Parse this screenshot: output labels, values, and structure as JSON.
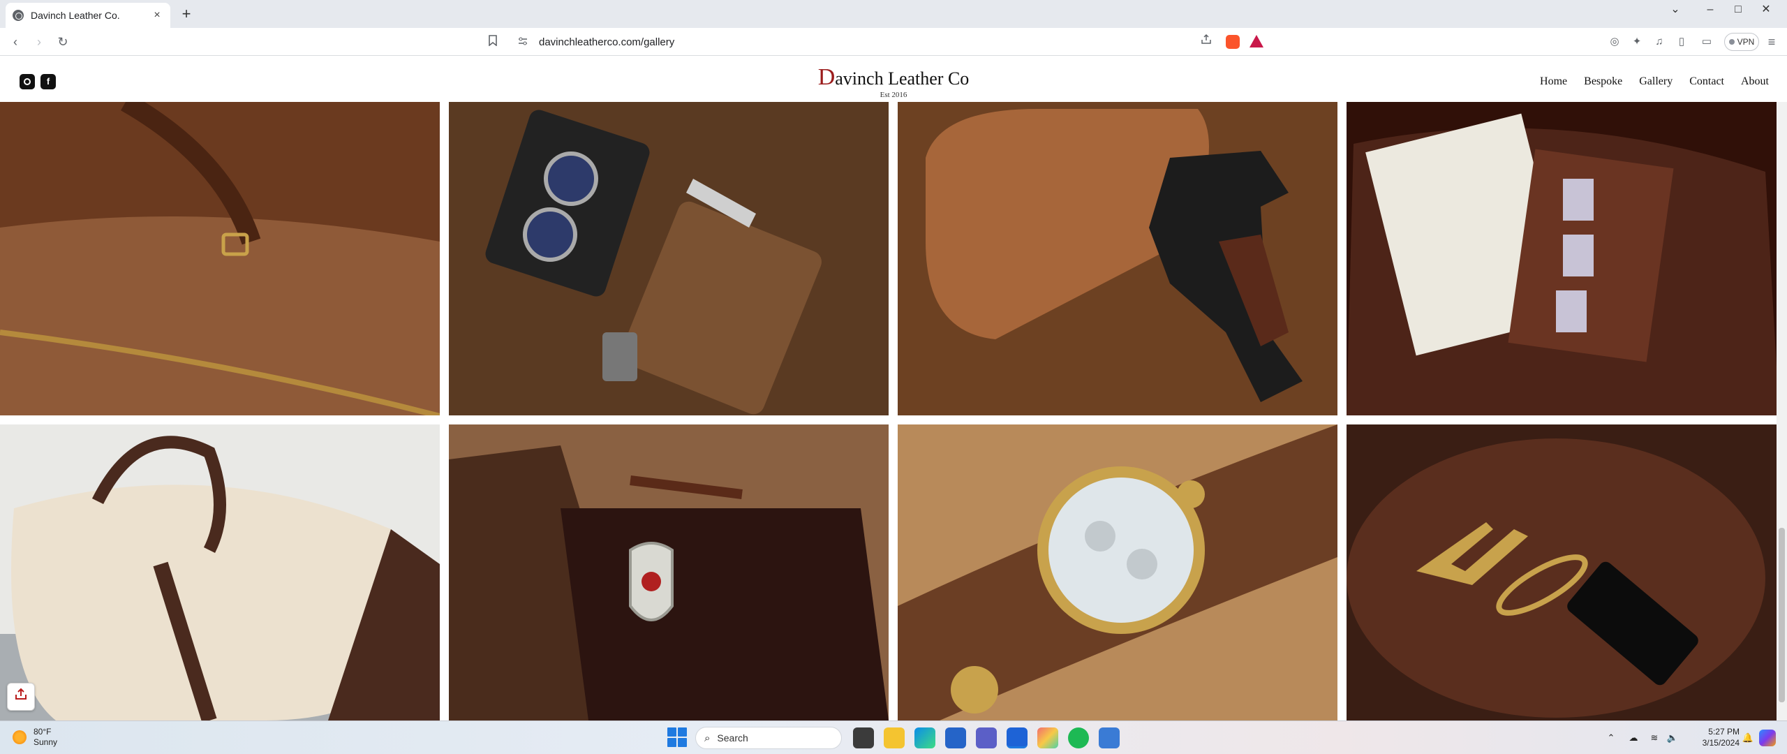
{
  "browser": {
    "tab_title": "Davinch Leather Co.",
    "tab_close": "×",
    "new_tab": "+",
    "url": "davinchleatherco.com/gallery",
    "vpn_label": "VPN",
    "window_controls": {
      "tabs": "⌄",
      "minimize": "–",
      "maximize": "□",
      "close": "✕"
    },
    "nav": {
      "back": "‹",
      "forward": "›",
      "reload": "↻"
    }
  },
  "site": {
    "brand_initial": "D",
    "brand_rest": "avinch Leather Co",
    "established": "Est 2016",
    "social": [
      {
        "icon": "instagram-icon"
      },
      {
        "icon": "facebook-icon",
        "glyph": "f"
      }
    ],
    "nav": [
      "Home",
      "Bespoke",
      "Gallery",
      "Contact",
      "About"
    ]
  },
  "gallery": {
    "photos": [
      {
        "subject": "duffle-bag-zipper-photo",
        "colors": [
          "#6b3a1f",
          "#8f5a38",
          "#4a2412"
        ]
      },
      {
        "subject": "camera-wallet-photo",
        "colors": [
          "#5a3a22",
          "#3b2412",
          "#7b5232"
        ]
      },
      {
        "subject": "tooled-pistol-case-photo",
        "colors": [
          "#a7663a",
          "#6d4122",
          "#402414"
        ]
      },
      {
        "subject": "leather-planner-photo",
        "colors": [
          "#4d2418",
          "#6a3422",
          "#301008"
        ]
      },
      {
        "subject": "canvas-duffle-bag-photo",
        "colors": [
          "#ece1cf",
          "#d2c3ad",
          "#4a2a1e"
        ]
      },
      {
        "subject": "badge-wallet-photo",
        "colors": [
          "#4a2c1c",
          "#2c1410",
          "#8a6142"
        ]
      },
      {
        "subject": "watch-strap-photo",
        "colors": [
          "#6b3e24",
          "#3c2414",
          "#b88a5a"
        ]
      },
      {
        "subject": "keychain-tool-photo",
        "colors": [
          "#3a1e14",
          "#5a2e1e",
          "#22100a"
        ]
      }
    ]
  },
  "taskbar": {
    "temperature": "80°F",
    "condition": "Sunny",
    "search_label": "Search",
    "time": "5:27 PM",
    "date": "3/15/2024"
  },
  "colors": {
    "brand_red": "#9b1c1c",
    "chrome_bg": "#e6e9ee",
    "accent_blue": "#1f7ae0"
  }
}
